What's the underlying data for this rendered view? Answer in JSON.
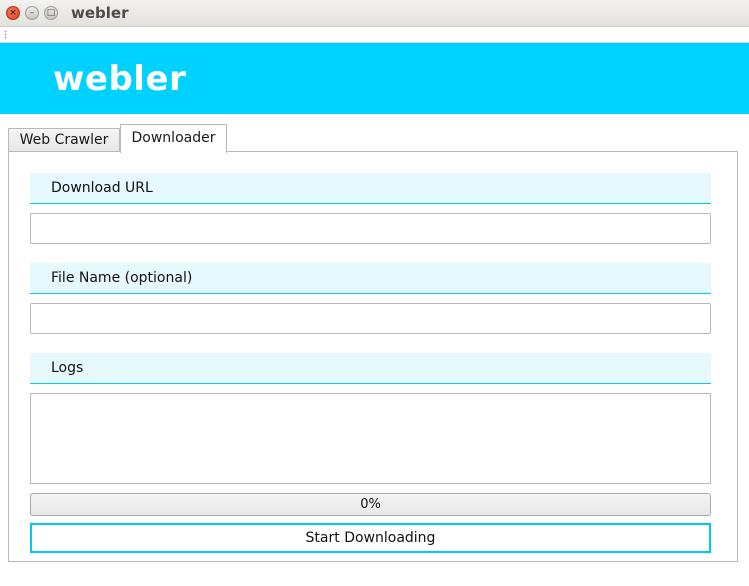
{
  "window": {
    "title": "webler",
    "close_glyph": "×",
    "minimize_glyph": "–",
    "maximize_glyph": "□"
  },
  "banner": {
    "brand": "webler",
    "color": "#00d2ff"
  },
  "tabs": [
    {
      "label": "Web Crawler",
      "active": false
    },
    {
      "label": "Downloader",
      "active": true
    }
  ],
  "downloader": {
    "url_label": "Download URL",
    "url_value": "",
    "filename_label": "File Name (optional)",
    "filename_value": "",
    "logs_label": "Logs",
    "logs_value": "",
    "progress": {
      "value": 0,
      "text": "0%"
    },
    "start_label": "Start Downloading"
  },
  "colors": {
    "accent": "#00c8f5",
    "label_bg": "#e6f9fe"
  }
}
